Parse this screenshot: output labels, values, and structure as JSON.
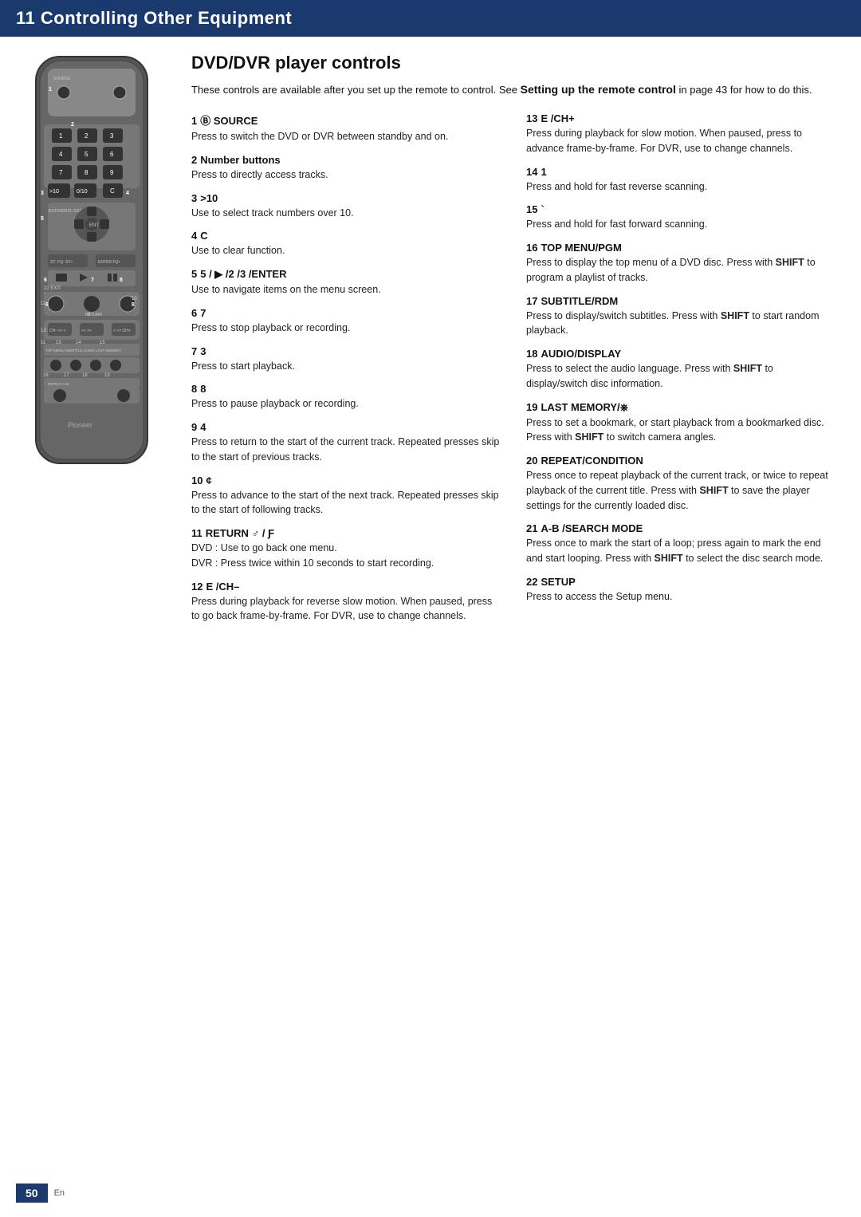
{
  "header": {
    "chapter": "11",
    "title": "Controlling Other Equipment"
  },
  "section": {
    "title": "DVD/DVR player controls",
    "intro": "These controls are available after you set up the remote to control. See",
    "intro_bold": "Setting up the remote control",
    "intro_end": "in page 43 for how to do this."
  },
  "controls_left": [
    {
      "num": "1",
      "label": "SOURCE",
      "label_style": "icon_bold",
      "desc": "Press to switch the DVD or DVR between standby and on."
    },
    {
      "num": "2",
      "label": "Number buttons",
      "label_style": "bold_normal",
      "desc": "Press to directly access tracks."
    },
    {
      "num": "3",
      "label": ">10",
      "label_style": "bold",
      "desc": "Use to select track numbers over 10."
    },
    {
      "num": "4",
      "label": "C",
      "label_style": "bold",
      "desc": "Use to clear function."
    },
    {
      "num": "5",
      "label": "5 /  /2 /3 /ENTER",
      "label_style": "bold",
      "desc": "Use to navigate items on the menu screen."
    },
    {
      "num": "6",
      "label": "7",
      "label_style": "bold",
      "desc": "Press to stop playback or recording."
    },
    {
      "num": "7",
      "label": "3",
      "label_style": "bold",
      "desc": "Press to start playback."
    },
    {
      "num": "8",
      "label": "8",
      "label_style": "bold",
      "desc": "Press to pause playback or recording."
    },
    {
      "num": "9",
      "label": "4",
      "label_style": "bold",
      "desc": "Press to return to the start of the current track. Repeated presses skip to the start of previous tracks."
    },
    {
      "num": "10",
      "label": "¢",
      "label_style": "bold",
      "desc": "Press to advance to the start of the next track. Repeated presses skip to the start of following tracks."
    },
    {
      "num": "11",
      "label": "RETURN ♂ / ƒ",
      "label_style": "bold",
      "desc_parts": [
        {
          "text": "DVD : Use to go back one menu."
        },
        {
          "text": "DVR : Press twice within 10 seconds to start recording."
        }
      ]
    },
    {
      "num": "12",
      "label": "e  /CH–",
      "label_style": "bold",
      "desc": "Press during playback for reverse slow motion. When paused, press to go back frame-by-frame. For DVR, use to change channels."
    }
  ],
  "controls_right": [
    {
      "num": "13",
      "label": "E  /CH+",
      "label_style": "bold",
      "desc": "Press during playback for slow motion. When paused, press to advance frame-by-frame. For DVR, use to change channels."
    },
    {
      "num": "14",
      "label": "1",
      "label_style": "bold",
      "desc": "Press and hold for fast reverse scanning."
    },
    {
      "num": "15",
      "label": "`",
      "label_style": "bold",
      "desc": "Press and hold for fast forward scanning."
    },
    {
      "num": "16",
      "label": "TOP MENU/PGM",
      "label_style": "bold_upper",
      "desc_parts": [
        {
          "text": "Press to display the top menu of a DVD disc. Press with "
        },
        {
          "text": "SHIFT",
          "bold": true
        },
        {
          "text": " to program a playlist of tracks."
        }
      ]
    },
    {
      "num": "17",
      "label": "SUBTITLE/RDM",
      "label_style": "bold_upper",
      "desc_parts": [
        {
          "text": "Press to display/switch subtitles. Press with "
        },
        {
          "text": "SHIFT",
          "bold": true
        },
        {
          "text": " to start random playback."
        }
      ]
    },
    {
      "num": "18",
      "label": "AUDIO/DISPLAY",
      "label_style": "bold_upper",
      "desc_parts": [
        {
          "text": "Press to select the audio language. Press with "
        },
        {
          "text": "SHIFT",
          "bold": true
        },
        {
          "text": " to display/switch disc information."
        }
      ]
    },
    {
      "num": "19",
      "label": "LAST MEMORY/⊡",
      "label_style": "bold_upper",
      "desc_parts": [
        {
          "text": "Press to set a bookmark, or start playback from a bookmarked disc. Press with "
        },
        {
          "text": "SHIFT",
          "bold": true
        },
        {
          "text": " to switch camera angles."
        }
      ]
    },
    {
      "num": "20",
      "label": "REPEAT/CONDITION",
      "label_style": "bold_upper",
      "desc_parts": [
        {
          "text": "Press once to repeat playback of the current track, or twice to repeat playback of the current title. Press with "
        },
        {
          "text": "SHIFT",
          "bold": true
        },
        {
          "text": " to save the player settings for the currently loaded disc."
        }
      ]
    },
    {
      "num": "21",
      "label": "A-B /SEARCH MODE",
      "label_style": "bold_upper",
      "desc_parts": [
        {
          "text": "Press once to mark the start of a loop; press again to mark the end and start looping. Press with "
        },
        {
          "text": "SHIFT",
          "bold": true
        },
        {
          "text": " to select the disc search mode."
        }
      ]
    },
    {
      "num": "22",
      "label": "SETUP",
      "label_style": "bold_upper",
      "desc": "Press to access the Setup menu."
    }
  ],
  "footer": {
    "page_num": "50",
    "lang": "En"
  }
}
